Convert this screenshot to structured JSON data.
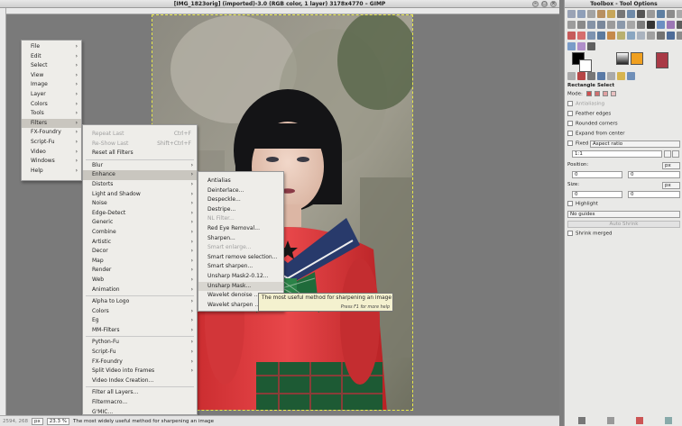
{
  "window": {
    "title": "[IMG_1823orig] (imported)-3.0 (RGB color, 1 layer) 3178x4770 – GIMP",
    "buttons": [
      "–",
      "□",
      "×"
    ]
  },
  "menubar_menu": {
    "items": [
      {
        "label": "File",
        "arrow": true
      },
      {
        "label": "Edit",
        "arrow": true
      },
      {
        "label": "Select",
        "arrow": true
      },
      {
        "label": "View",
        "arrow": true
      },
      {
        "label": "Image",
        "arrow": true
      },
      {
        "label": "Layer",
        "arrow": true
      },
      {
        "label": "Colors",
        "arrow": true
      },
      {
        "label": "Tools",
        "arrow": true
      },
      {
        "label": "Filters",
        "arrow": true,
        "selected": true
      },
      {
        "label": "FX-Foundry",
        "arrow": true
      },
      {
        "label": "Script-Fu",
        "arrow": true
      },
      {
        "label": "Video",
        "arrow": true
      },
      {
        "label": "Windows",
        "arrow": true
      },
      {
        "label": "Help",
        "arrow": true
      }
    ]
  },
  "filters_menu": {
    "top": [
      {
        "label": "Repeat Last",
        "shortcut": "Ctrl+F",
        "disabled": true
      },
      {
        "label": "Re-Show Last",
        "shortcut": "Shift+Ctrl+F",
        "disabled": true
      },
      {
        "label": "Reset all Filters"
      }
    ],
    "groups": [
      {
        "label": "Blur",
        "arrow": true
      },
      {
        "label": "Enhance",
        "arrow": true,
        "selected": true
      },
      {
        "label": "Distorts",
        "arrow": true
      },
      {
        "label": "Light and Shadow",
        "arrow": true
      },
      {
        "label": "Noise",
        "arrow": true
      },
      {
        "label": "Edge-Detect",
        "arrow": true
      },
      {
        "label": "Generic",
        "arrow": true
      },
      {
        "label": "Combine",
        "arrow": true
      },
      {
        "label": "Artistic",
        "arrow": true
      },
      {
        "label": "Decor",
        "arrow": true
      },
      {
        "label": "Map",
        "arrow": true
      },
      {
        "label": "Render",
        "arrow": true
      },
      {
        "label": "Web",
        "arrow": true
      },
      {
        "label": "Animation",
        "arrow": true
      }
    ],
    "extras": [
      {
        "label": "Alpha to Logo",
        "arrow": true
      },
      {
        "label": "Colors",
        "arrow": true
      },
      {
        "label": "Eg",
        "arrow": true
      },
      {
        "label": "MM-Filters",
        "arrow": true
      }
    ],
    "scripts": [
      {
        "label": "Python-Fu",
        "arrow": true
      },
      {
        "label": "Script-Fu",
        "arrow": true
      },
      {
        "label": "FX-Foundry",
        "arrow": true
      },
      {
        "label": "Split Video into Frames",
        "arrow": true
      },
      {
        "label": "Video Index Creation..."
      }
    ],
    "bottom": [
      {
        "label": "Filter all Layers..."
      },
      {
        "label": "Filtermacro..."
      },
      {
        "label": "G'MIC..."
      }
    ]
  },
  "enhance_menu": {
    "items": [
      {
        "label": "Antialias"
      },
      {
        "label": "Deinterlace..."
      },
      {
        "label": "Despeckle..."
      },
      {
        "label": "Destripe..."
      },
      {
        "label": "NL Filter...",
        "disabled": true
      },
      {
        "label": "Red Eye Removal..."
      },
      {
        "label": "Sharpen..."
      },
      {
        "label": "Smart enlarge...",
        "disabled": true
      },
      {
        "label": "Smart remove selection..."
      },
      {
        "label": "Smart sharpen..."
      },
      {
        "label": "Unsharp Mask2-0.12..."
      },
      {
        "label": "Unsharp Mask...",
        "highlight": true
      },
      {
        "label": "Wavelet denoise ..."
      },
      {
        "label": "Wavelet sharpen ..."
      }
    ]
  },
  "tooltip": {
    "text": "The most useful method for sharpening an image",
    "hint": "Press F1 for more help"
  },
  "statusbar": {
    "coords": "2594, 268",
    "unit": "px",
    "zoom": "23.3 %",
    "message": "The most widely useful method for sharpening an image"
  },
  "toolbox": {
    "title": "Toolbox - Tool Options",
    "tool_name": "Rectangle Select",
    "mode_label": "Mode:",
    "options": [
      {
        "label": "Antialiasing",
        "disabled": true
      },
      {
        "label": "Feather edges"
      },
      {
        "label": "Rounded corners"
      },
      {
        "label": "Expand from center"
      }
    ],
    "fixed_label": "Fixed",
    "fixed_value": "Aspect ratio",
    "ratio_value": "1:1",
    "position_label": "Position:",
    "position_unit": "px",
    "position_x": "0",
    "position_y": "0",
    "size_label": "Size:",
    "size_unit": "px",
    "size_w": "0",
    "size_h": "0",
    "highlight_label": "Highlight",
    "guides_value": "No guides",
    "auto_shrink": "Auto Shrink",
    "shrink_merged": "Shrink merged",
    "colors": {
      "fg": "#000000",
      "bg": "#ffffff",
      "accent": "#f0a020"
    }
  }
}
